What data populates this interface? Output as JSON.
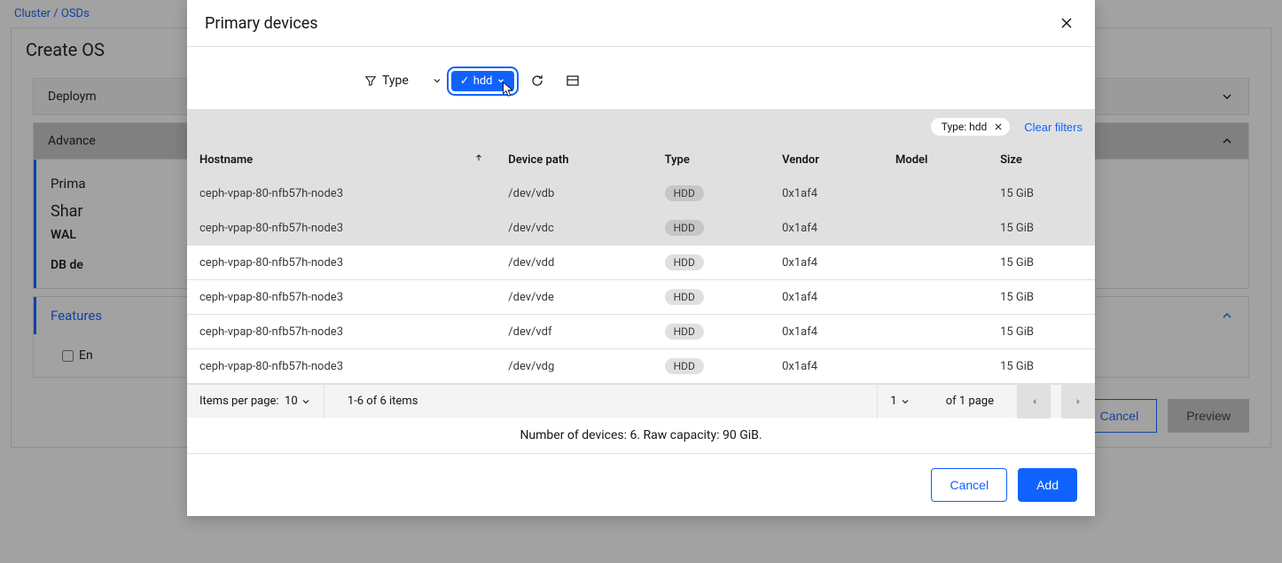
{
  "breadcrumb": {
    "root": "Cluster",
    "current": "OSDs"
  },
  "page": {
    "title": "Create OS"
  },
  "bg_panels": {
    "deploy": "Deploym",
    "advanced": "Advance",
    "primary": "Prima",
    "shared": "Shar",
    "wal": "WAL",
    "db": "DB de",
    "features": "Features",
    "encrypt": "En"
  },
  "bg_footer": {
    "cancel": "Cancel",
    "preview": "Preview"
  },
  "modal": {
    "title": "Primary devices",
    "filter_label": "Type",
    "tag": {
      "state": "✓",
      "label": "hdd"
    },
    "filter_pill": "Type: hdd",
    "clear_filters": "Clear filters",
    "columns": {
      "hostname": "Hostname",
      "device_path": "Device path",
      "type": "Type",
      "vendor": "Vendor",
      "model": "Model",
      "size": "Size"
    },
    "rows": [
      {
        "hostname": "ceph-vpap-80-nfb57h-node3",
        "path": "/dev/vdb",
        "type": "HDD",
        "vendor": "0x1af4",
        "model": "",
        "size": "15 GiB",
        "selected": true
      },
      {
        "hostname": "ceph-vpap-80-nfb57h-node3",
        "path": "/dev/vdc",
        "type": "HDD",
        "vendor": "0x1af4",
        "model": "",
        "size": "15 GiB",
        "selected": true
      },
      {
        "hostname": "ceph-vpap-80-nfb57h-node3",
        "path": "/dev/vdd",
        "type": "HDD",
        "vendor": "0x1af4",
        "model": "",
        "size": "15 GiB",
        "selected": false
      },
      {
        "hostname": "ceph-vpap-80-nfb57h-node3",
        "path": "/dev/vde",
        "type": "HDD",
        "vendor": "0x1af4",
        "model": "",
        "size": "15 GiB",
        "selected": false
      },
      {
        "hostname": "ceph-vpap-80-nfb57h-node3",
        "path": "/dev/vdf",
        "type": "HDD",
        "vendor": "0x1af4",
        "model": "",
        "size": "15 GiB",
        "selected": false
      },
      {
        "hostname": "ceph-vpap-80-nfb57h-node3",
        "path": "/dev/vdg",
        "type": "HDD",
        "vendor": "0x1af4",
        "model": "",
        "size": "15 GiB",
        "selected": false
      }
    ],
    "pagination": {
      "items_per_page_label": "Items per page:",
      "items_per_page_value": "10",
      "range": "1-6 of 6 items",
      "page_num": "1",
      "page_of": "of 1 page"
    },
    "summary": "Number of devices: 6. Raw capacity: 90 GiB.",
    "footer": {
      "cancel": "Cancel",
      "add": "Add"
    }
  }
}
